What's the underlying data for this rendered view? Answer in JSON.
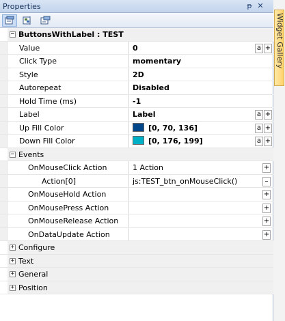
{
  "panel": {
    "title": "Properties",
    "pin_glyph": "ᵽ",
    "close_glyph": "✕"
  },
  "toolbar": {
    "tools": [
      {
        "icon": "categorized-view-icon",
        "active": true
      },
      {
        "icon": "alphabetical-view-icon",
        "active": false
      },
      {
        "icon": "property-pages-icon",
        "active": false
      }
    ]
  },
  "header": {
    "label": "ButtonsWithLabel : TEST",
    "expander": "−"
  },
  "rows": [
    {
      "name": "Value",
      "value": "0",
      "bold": true,
      "buttons": [
        "a",
        "+"
      ]
    },
    {
      "name": "Click Type",
      "value": "momentary",
      "bold": true,
      "buttons": []
    },
    {
      "name": "Style",
      "value": "2D",
      "bold": true,
      "buttons": []
    },
    {
      "name": "Autorepeat",
      "value": "Disabled",
      "bold": true,
      "buttons": []
    },
    {
      "name": "Hold Time (ms)",
      "value": "-1",
      "bold": true,
      "buttons": []
    },
    {
      "name": "Label",
      "value": "Label",
      "bold": true,
      "buttons": [
        "a",
        "+"
      ]
    },
    {
      "name": "Up Fill Color",
      "value": "[0, 70, 136]",
      "bold": true,
      "swatch": "#004688",
      "buttons": [
        "a",
        "+"
      ]
    },
    {
      "name": "Down Fill Color",
      "value": "[0, 176, 199]",
      "bold": true,
      "swatch": "#00b0c7",
      "buttons": [
        "a",
        "+"
      ]
    }
  ],
  "events": {
    "label": "Events",
    "expander": "−",
    "items": [
      {
        "name": "OnMouseClick Action",
        "value": "1 Action",
        "expander": "−",
        "button": "+"
      },
      {
        "name": "Action[0]",
        "value": "js:TEST_btn_onMouseClick()",
        "button": "–"
      },
      {
        "name": "OnMouseHold Action",
        "value": "",
        "button": "+"
      },
      {
        "name": "OnMousePress Action",
        "value": "",
        "button": "+"
      },
      {
        "name": "OnMouseRelease Action",
        "value": "",
        "button": "+"
      },
      {
        "name": "OnDataUpdate Action",
        "value": "",
        "button": "+"
      }
    ]
  },
  "categories": [
    {
      "label": "Configure",
      "expander": "+"
    },
    {
      "label": "Text",
      "expander": "+"
    },
    {
      "label": "General",
      "expander": "+"
    },
    {
      "label": "Position",
      "expander": "+"
    }
  ],
  "sidetab": {
    "label": "Widget Gallery"
  }
}
